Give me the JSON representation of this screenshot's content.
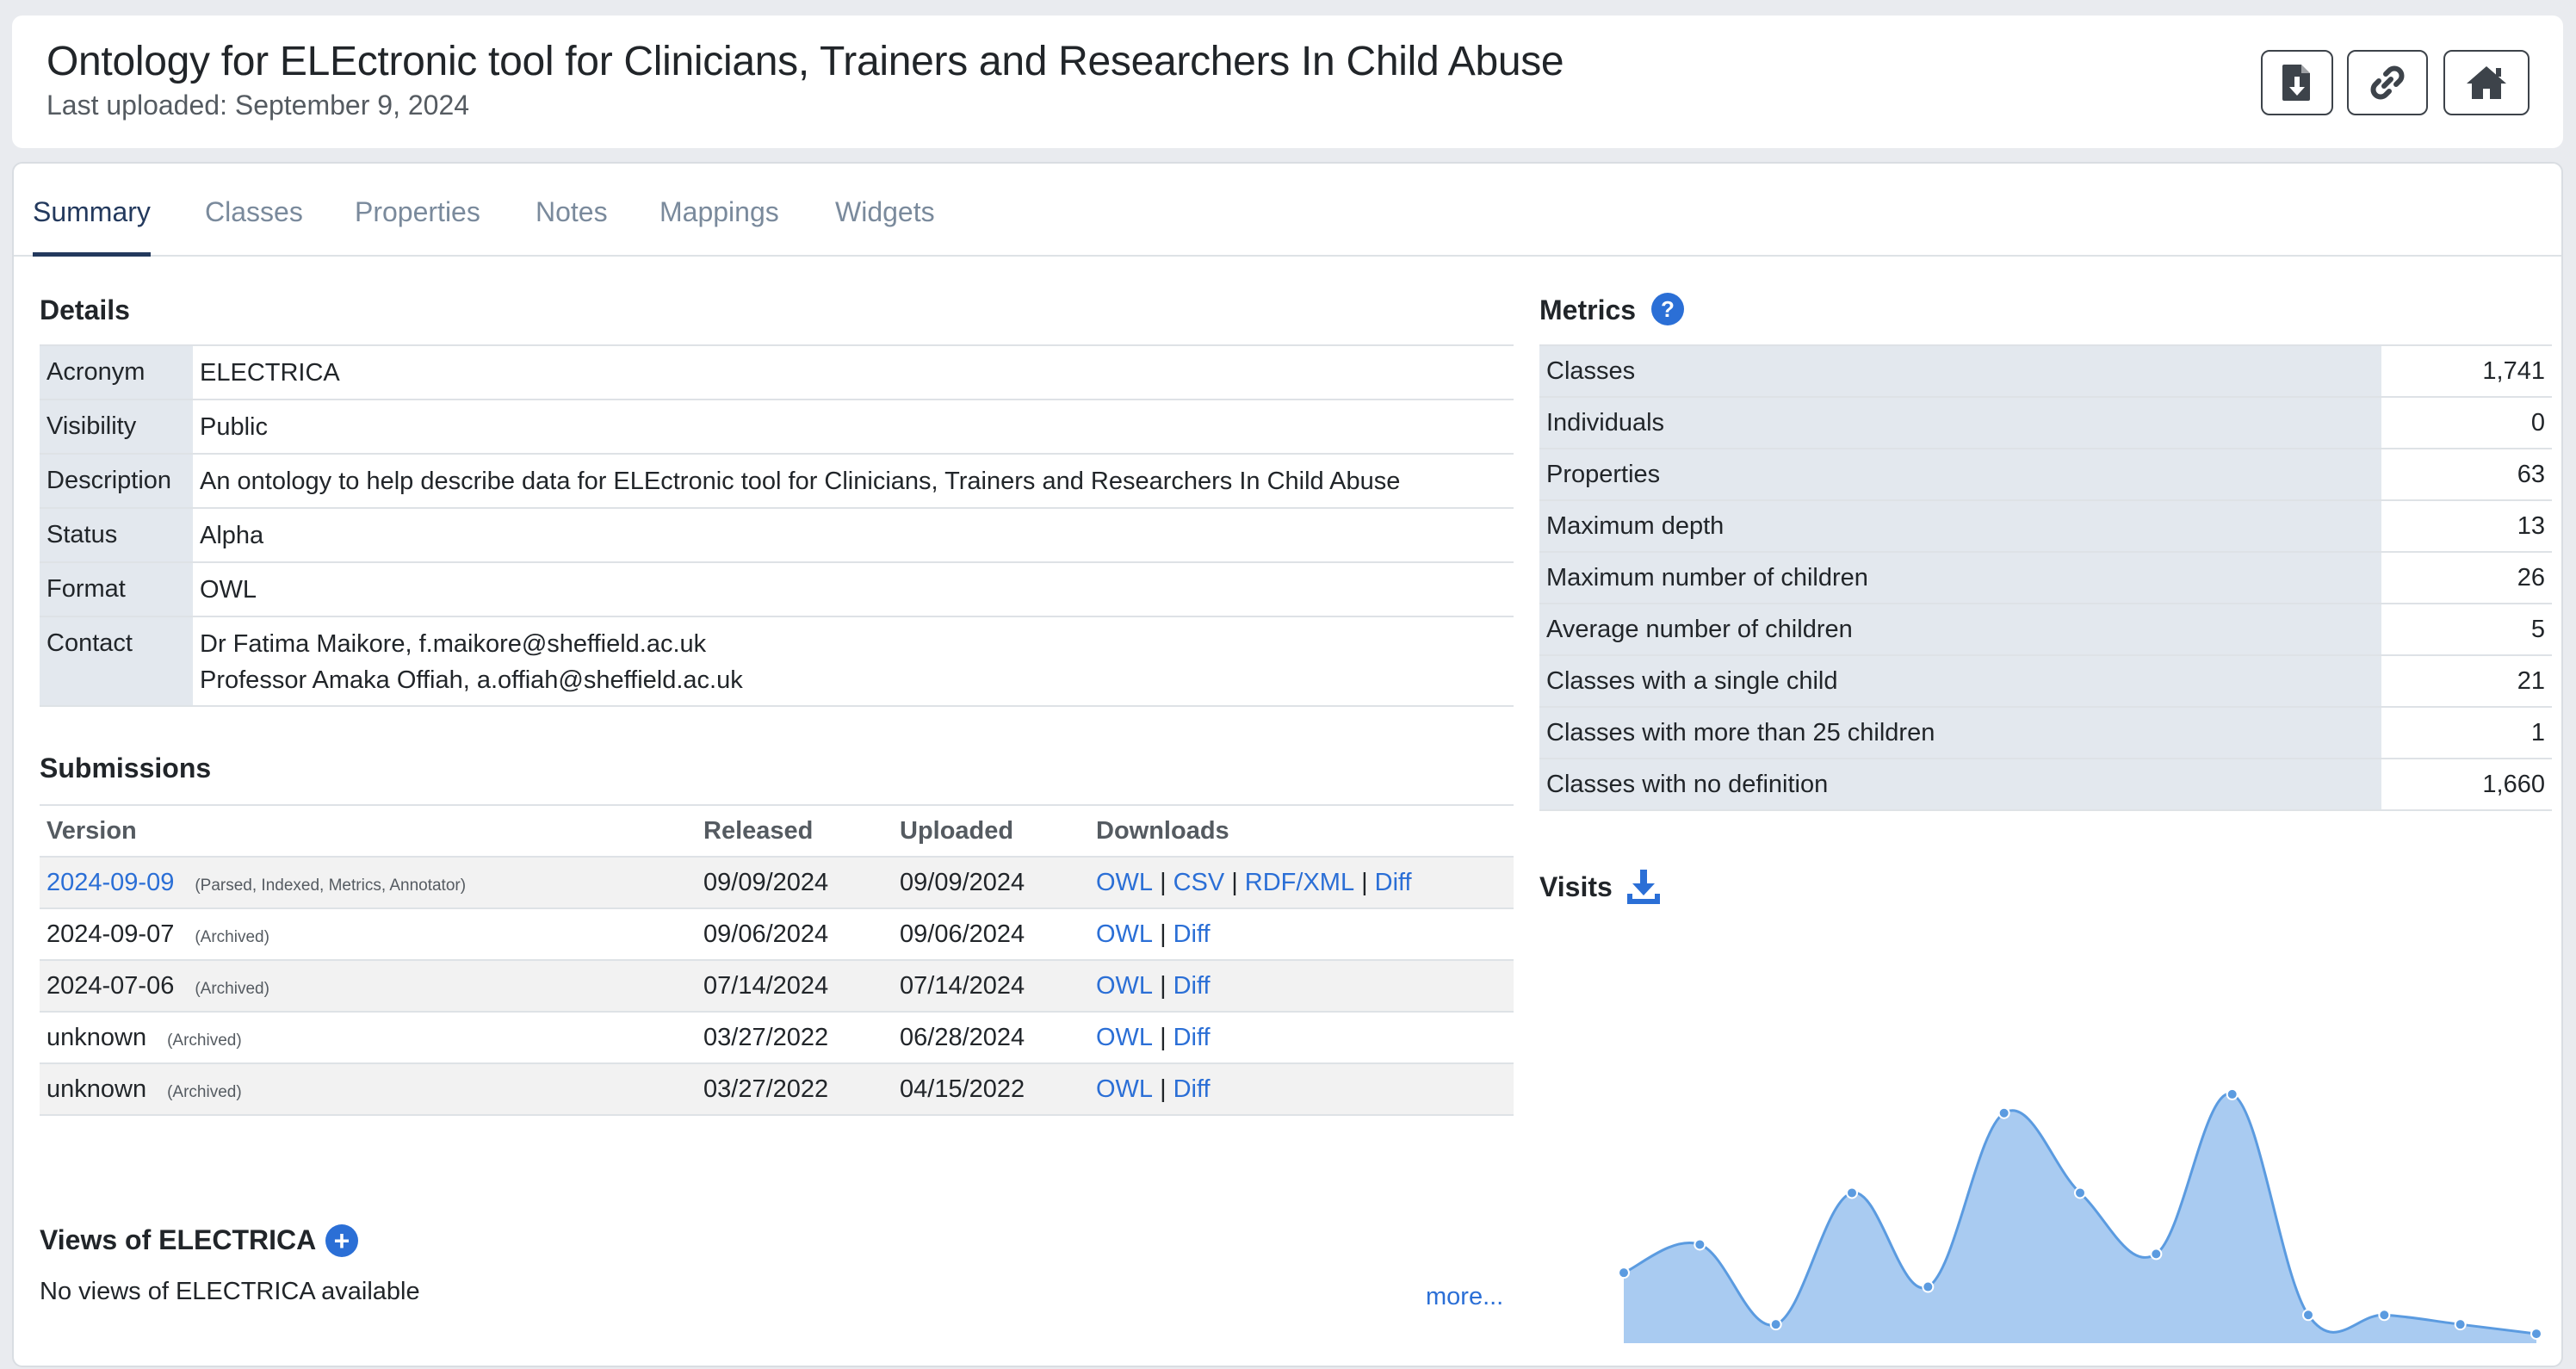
{
  "header": {
    "title": "Ontology for ELEctronic tool for Clinicians, Trainers and Researchers In Child Abuse",
    "last_uploaded": "Last uploaded: September 9, 2024",
    "buttons": [
      {
        "icon": "file-download-icon"
      },
      {
        "icon": "link-icon"
      },
      {
        "icon": "home-icon"
      }
    ]
  },
  "tabs": [
    "Summary",
    "Classes",
    "Properties",
    "Notes",
    "Mappings",
    "Widgets"
  ],
  "active_tab": "Summary",
  "details": {
    "title": "Details",
    "rows": [
      {
        "label": "Acronym",
        "value": "ELECTRICA"
      },
      {
        "label": "Visibility",
        "value": "Public"
      },
      {
        "label": "Description",
        "value": "An ontology to help describe data for ELEctronic tool for Clinicians, Trainers and Researchers In Child Abuse"
      },
      {
        "label": "Status",
        "value": "Alpha"
      },
      {
        "label": "Format",
        "value": "OWL"
      }
    ],
    "contact_label": "Contact",
    "contacts": [
      "Dr Fatima Maikore, f.maikore@sheffield.ac.uk",
      "Professor Amaka Offiah, a.offiah@sheffield.ac.uk"
    ]
  },
  "submissions": {
    "title": "Submissions",
    "columns": [
      "Version",
      "Released",
      "Uploaded",
      "Downloads"
    ],
    "rows": [
      {
        "version": "2024-09-09",
        "note": "(Parsed, Indexed, Metrics, Annotator)",
        "released": "09/09/2024",
        "uploaded": "09/09/2024",
        "downloads": [
          "OWL",
          "CSV",
          "RDF/XML",
          "Diff"
        ]
      },
      {
        "version": "2024-09-07",
        "note": "(Archived)",
        "released": "09/06/2024",
        "uploaded": "09/06/2024",
        "downloads": [
          "OWL",
          "Diff"
        ]
      },
      {
        "version": "2024-07-06",
        "note": "(Archived)",
        "released": "07/14/2024",
        "uploaded": "07/14/2024",
        "downloads": [
          "OWL",
          "Diff"
        ]
      },
      {
        "version": "unknown",
        "note": "(Archived)",
        "released": "03/27/2022",
        "uploaded": "06/28/2024",
        "downloads": [
          "OWL",
          "Diff"
        ]
      },
      {
        "version": "unknown",
        "note": "(Archived)",
        "released": "03/27/2022",
        "uploaded": "04/15/2022",
        "downloads": [
          "OWL",
          "Diff"
        ]
      }
    ],
    "more": "more..."
  },
  "views": {
    "title": "Views of ELECTRICA",
    "empty_text": "No views of ELECTRICA available"
  },
  "metrics": {
    "title": "Metrics",
    "rows": [
      {
        "label": "Classes",
        "value": "1,741"
      },
      {
        "label": "Individuals",
        "value": "0"
      },
      {
        "label": "Properties",
        "value": "63"
      },
      {
        "label": "Maximum depth",
        "value": "13"
      },
      {
        "label": "Maximum number of children",
        "value": "26"
      },
      {
        "label": "Average number of children",
        "value": "5"
      },
      {
        "label": "Classes with a single child",
        "value": "21"
      },
      {
        "label": "Classes with more than 25 children",
        "value": "1"
      },
      {
        "label": "Classes with no definition",
        "value": "1,660"
      }
    ]
  },
  "visits": {
    "title": "Visits"
  },
  "chart_data": {
    "type": "area",
    "title": "",
    "xlabel": "",
    "ylabel": "",
    "ylim": [
      0,
      55
    ],
    "values": [
      15,
      21,
      4,
      32,
      12,
      49,
      32,
      19,
      53,
      6,
      6,
      4,
      2
    ],
    "fill_color": "#a9cbf1",
    "line_color": "#5b9be0",
    "point_color": "#5b9be0",
    "grid": false
  }
}
